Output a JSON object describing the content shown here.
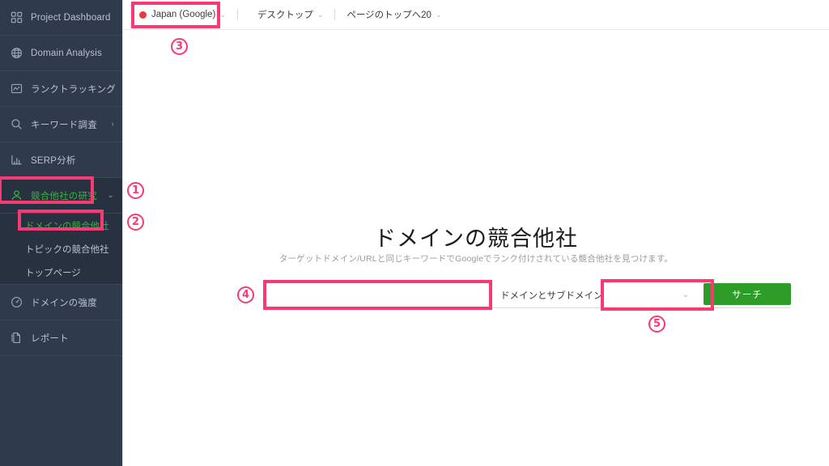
{
  "sidebar": {
    "items": [
      {
        "label": "Project Dashboard",
        "icon": "grid-icon",
        "has_chevron": false,
        "active": false
      },
      {
        "label": "Domain Analysis",
        "icon": "globe-icon",
        "has_chevron": false,
        "active": false
      },
      {
        "label": "ランクトラッキング",
        "icon": "chart-square-icon",
        "has_chevron": true,
        "active": false
      },
      {
        "label": "キーワード調査",
        "icon": "search-icon",
        "has_chevron": true,
        "active": false
      },
      {
        "label": "SERP分析",
        "icon": "bar-chart-icon",
        "has_chevron": false,
        "active": false
      },
      {
        "label": "競合他社の研究",
        "icon": "user-icon",
        "has_chevron": true,
        "active": true
      }
    ],
    "submenu": [
      {
        "label": "ドメインの競合他社",
        "active": true
      },
      {
        "label": "トピックの競合他社",
        "active": false
      },
      {
        "label": "トップページ",
        "active": false
      }
    ],
    "items_after": [
      {
        "label": "ドメインの強度",
        "icon": "gauge-icon",
        "has_chevron": false,
        "active": false
      },
      {
        "label": "レポート",
        "icon": "document-icon",
        "has_chevron": false,
        "active": false
      }
    ],
    "chevron_right_glyph": "›",
    "chevron_down_glyph": "⌄",
    "accent_active_color": "#3bb143",
    "background_color": "#2f3a4d"
  },
  "header": {
    "locale_label": "Japan (Google)",
    "device_label": "デスクトップ",
    "top_pages_label": "ページのトップへ20",
    "caret_glyph": "⌄",
    "flag_color": "#e8393c"
  },
  "main": {
    "title": "ドメインの競合他社",
    "subtitle": "ターゲットドメイン/URLと同じキーワードでGoogleでランク付けされている競合他社を見つけます。",
    "form": {
      "domain_value": "",
      "domain_placeholder": "",
      "scope_selected": "ドメインとサブドメイン",
      "scope_caret_glyph": "⌄",
      "search_button_label": "サーチ",
      "search_button_color": "#2d9c28"
    }
  },
  "annotations": {
    "highlight_color": "#f73a73",
    "markers": [
      {
        "id": "1",
        "glyph": "①",
        "target": "sidebar-item-competitor-research"
      },
      {
        "id": "2",
        "glyph": "②",
        "target": "submenu-item-domain-competitors"
      },
      {
        "id": "3",
        "glyph": "③",
        "target": "header-locale-selector"
      },
      {
        "id": "4",
        "glyph": "④",
        "target": "domain-input"
      },
      {
        "id": "5",
        "glyph": "⑤",
        "target": "search-button"
      }
    ]
  }
}
